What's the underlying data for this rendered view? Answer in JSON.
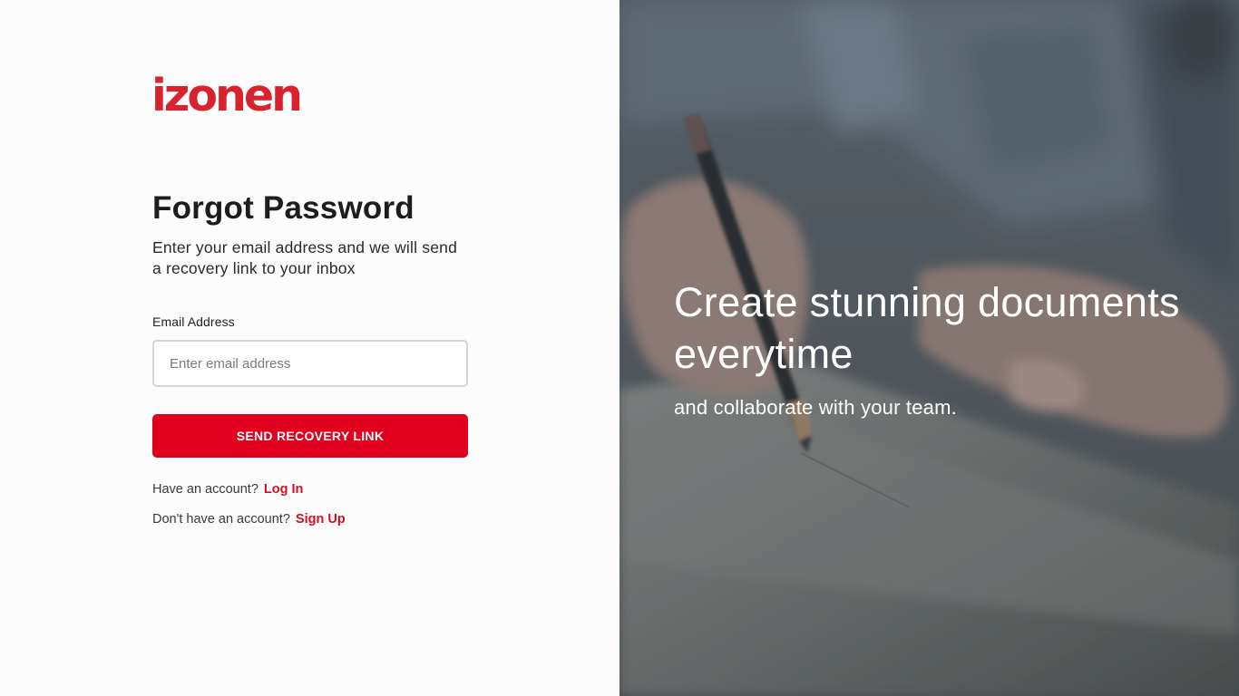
{
  "brand": {
    "logo_text": "izonen",
    "accent_color": "#e1001d"
  },
  "form": {
    "title": "Forgot Password",
    "subtitle": "Enter your email address and we will send a recovery link to your inbox",
    "email_label": "Email Address",
    "email_placeholder": "Enter email address",
    "email_value": "",
    "submit_label": "SEND RECOVERY LINK"
  },
  "links": {
    "login_prompt": "Have an account?",
    "login_label": "Log In",
    "signup_prompt": "Don't have an account?",
    "signup_label": "Sign Up"
  },
  "hero": {
    "title": "Create stunning documents everytime",
    "subtitle": "and collaborate with your team."
  }
}
